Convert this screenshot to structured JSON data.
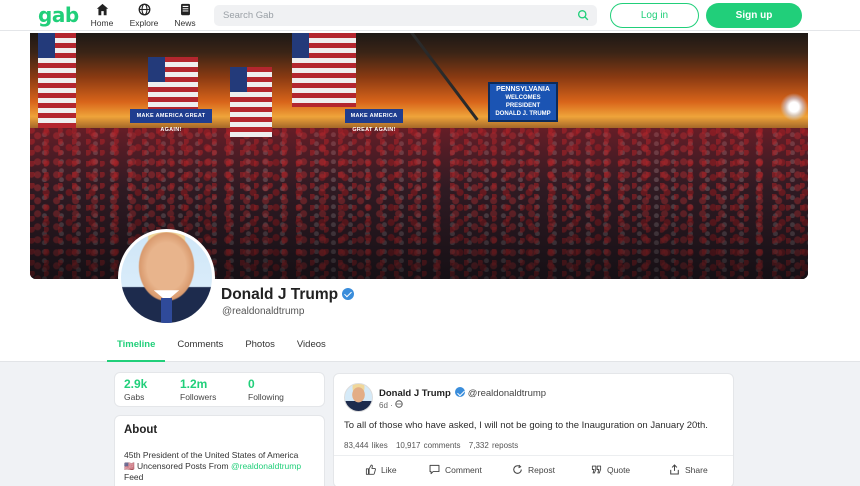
{
  "nav": {
    "logo": "gab",
    "items": [
      {
        "label": "Home",
        "icon": "home-icon"
      },
      {
        "label": "Explore",
        "icon": "globe-icon"
      },
      {
        "label": "News",
        "icon": "news-icon"
      }
    ],
    "search_placeholder": "Search Gab",
    "login_label": "Log in",
    "signup_label": "Sign up"
  },
  "cover": {
    "banner_left": "MAKE AMERICA GREAT AGAIN!",
    "banner_right": "MAKE AMERICA GREAT AGAIN!",
    "screen_lines": [
      "PENNSYLVANIA",
      "WELCOMES",
      "PRESIDENT",
      "DONALD J. TRUMP"
    ]
  },
  "profile": {
    "name": "Donald J Trump",
    "handle": "@realdonaldtrump",
    "verified": true
  },
  "tabs": [
    {
      "label": "Timeline",
      "active": true
    },
    {
      "label": "Comments",
      "active": false
    },
    {
      "label": "Photos",
      "active": false
    },
    {
      "label": "Videos",
      "active": false
    }
  ],
  "stats": [
    {
      "value": "2.9k",
      "label": "Gabs"
    },
    {
      "value": "1.2m",
      "label": "Followers"
    },
    {
      "value": "0",
      "label": "Following"
    }
  ],
  "about": {
    "title": "About",
    "line1": "45th President of the United States of America",
    "line2_flag": "🇺🇸",
    "line2_prefix": "Uncensored Posts From",
    "line2_link": "@realdonaldtrump",
    "line3": "Feed"
  },
  "post": {
    "author": "Donald J Trump",
    "handle": "@realdonaldtrump",
    "time": "6d",
    "text": "To all of those who have asked, I will not be going to the Inauguration on January 20th.",
    "likes": "83,444 likes",
    "comments": "10,917 comments",
    "reposts": "7,332 reposts",
    "actions": {
      "like": "Like",
      "comment": "Comment",
      "repost": "Repost",
      "quote": "Quote",
      "share": "Share"
    }
  },
  "colors": {
    "accent": "#21cf7a",
    "verified": "#3a8ddb"
  }
}
